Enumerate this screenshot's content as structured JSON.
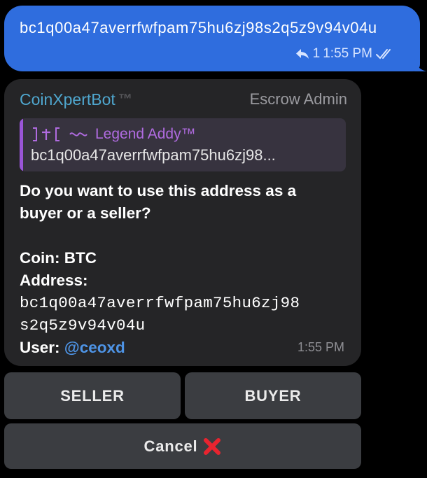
{
  "outgoing": {
    "text": "bc1q00a47averrfwfpam75hu6zj98s2q5z9v94v04u",
    "reply_count": "1",
    "time": "1:55 PM",
    "bubble_color": "#2f6dde"
  },
  "incoming": {
    "sender": "CoinXpertBot",
    "sender_suffix": "™",
    "role": "Escrow Admin",
    "reply": {
      "name": "𝔏𝔢𝔤𝔢𝔫𝔡𝔄𝔡𝔡𝔶 Legend Addy™",
      "name_display": "Legend Addy™",
      "text": "bc1q00a47averrfwfpam75hu6zj98..."
    },
    "question_line1": "Do you want to use this address as a",
    "question_line2": "buyer or a seller?",
    "coin_label": "Coin: BTC",
    "address_label": "Address:",
    "address_line1": "bc1q00a47averrfwfpam75hu6zj98",
    "address_line2": "s2q5z9v94v04u",
    "user_label": "User: ",
    "user_mention": "@ceoxd",
    "time": "1:55 PM"
  },
  "keyboard": {
    "seller": "SELLER",
    "buyer": "BUYER",
    "cancel": "Cancel"
  },
  "icons": {
    "reply": "reply-arrow-icon",
    "read": "double-check-icon",
    "cancel": "red-x-icon"
  }
}
